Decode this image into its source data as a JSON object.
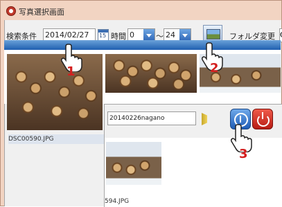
{
  "window": {
    "title": "写真選択画面"
  },
  "toolbar": {
    "search_label": "検索条件",
    "date_value": "2014/02/27",
    "calendar_day": "15",
    "time_label": "時間",
    "time_from": "0",
    "time_sep": "〜",
    "time_to": "24",
    "folder_change_label": "フォルダ変更",
    "folder_value": "C"
  },
  "thumbnails": [
    {
      "filename": "DSC00590.JPG"
    }
  ],
  "dialog": {
    "folder_value": "20140226nagano",
    "thumbnail_filename": "594.JPG"
  },
  "callouts": [
    "1",
    "2",
    "3"
  ]
}
